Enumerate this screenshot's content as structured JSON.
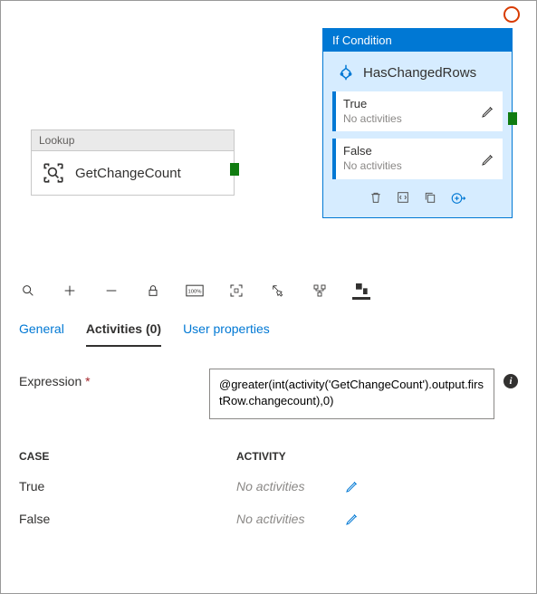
{
  "canvas": {
    "lookup": {
      "header": "Lookup",
      "name": "GetChangeCount"
    },
    "ifcondition": {
      "header": "If Condition",
      "title": "HasChangedRows",
      "branches": {
        "true": {
          "label": "True",
          "sub": "No activities"
        },
        "false": {
          "label": "False",
          "sub": "No activities"
        }
      }
    }
  },
  "tabs": {
    "general": "General",
    "activities": "Activities (0)",
    "user_properties": "User properties"
  },
  "form": {
    "expression_label": "Expression",
    "expression_value": "@greater(int(activity('GetChangeCount').output.firstRow.changecount),0)"
  },
  "table": {
    "header_case": "CASE",
    "header_activity": "ACTIVITY",
    "rows": [
      {
        "case": "True",
        "activity": "No activities"
      },
      {
        "case": "False",
        "activity": "No activities"
      }
    ]
  }
}
